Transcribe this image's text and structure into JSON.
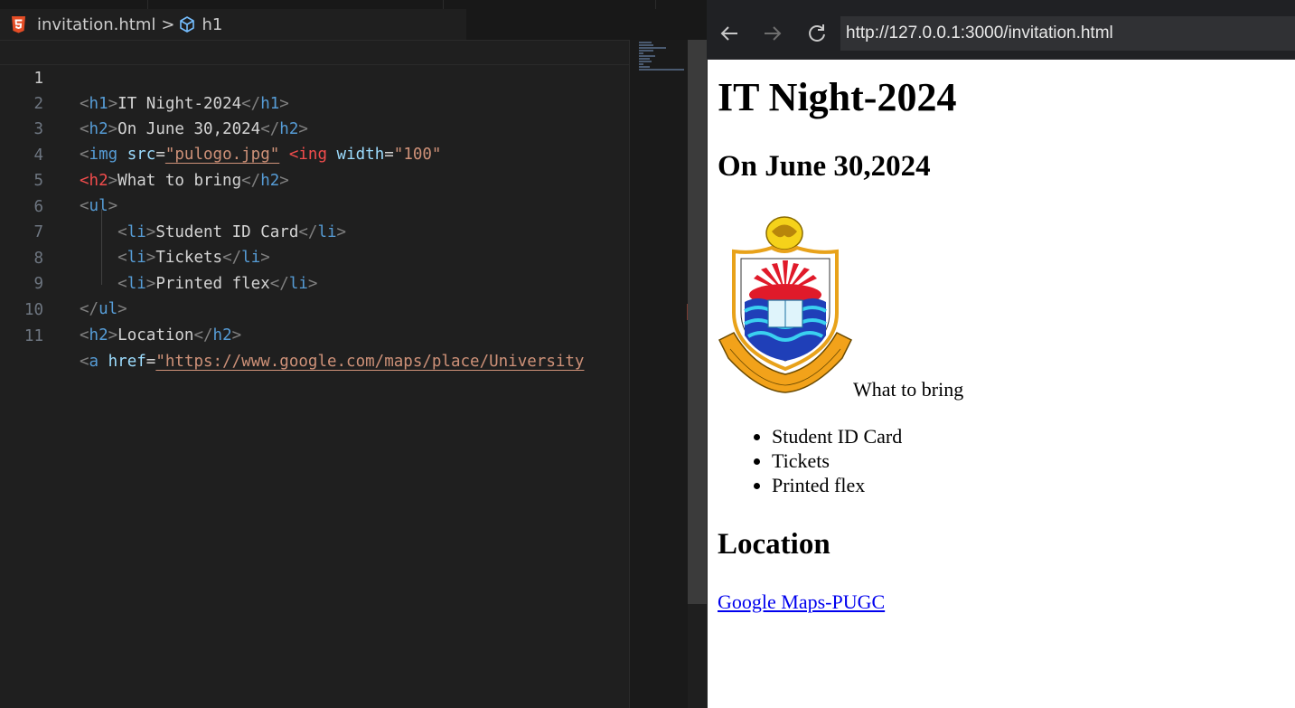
{
  "editor": {
    "breadcrumb": {
      "file": "invitation.html",
      "separator": ">",
      "symbol": "h1"
    },
    "lines": [
      {
        "n": "1"
      },
      {
        "n": "2"
      },
      {
        "n": "3"
      },
      {
        "n": "4"
      },
      {
        "n": "5"
      },
      {
        "n": "6"
      },
      {
        "n": "7"
      },
      {
        "n": "8"
      },
      {
        "n": "9"
      },
      {
        "n": "10"
      },
      {
        "n": "11"
      }
    ],
    "code": {
      "l1_text": "IT Night-2024",
      "l2_text": "On June 30,2024",
      "l3_src": "\"pulogo.jpg\"",
      "l3_bad": "<ing",
      "l3_width": "\"100\"",
      "l4_text": "What to bring",
      "l6_text": "Student ID Card",
      "l7_text": "Tickets",
      "l8_text": "Printed flex",
      "l10_text": "Location",
      "l11_href": "\"https://www.google.com/maps/place/University"
    }
  },
  "browser": {
    "back_icon": "back-arrow-icon",
    "forward_icon": "forward-arrow-icon",
    "reload_icon": "reload-icon",
    "url": "http://127.0.0.1:3000/invitation.html"
  },
  "page": {
    "heading": "IT Night-2024",
    "date": "On June 30,2024",
    "logo_alt": "University of the Punjab logo",
    "bring_label": "What to bring",
    "items": [
      "Student ID Card",
      "Tickets",
      "Printed flex"
    ],
    "location_heading": "Location",
    "link_text": "Google Maps-PUGC"
  },
  "colors": {
    "tag_name": "#569cd6",
    "error_tag": "#f14c4c",
    "attribute": "#9cdcfe",
    "string": "#ce9178",
    "link": "#0000ee"
  }
}
